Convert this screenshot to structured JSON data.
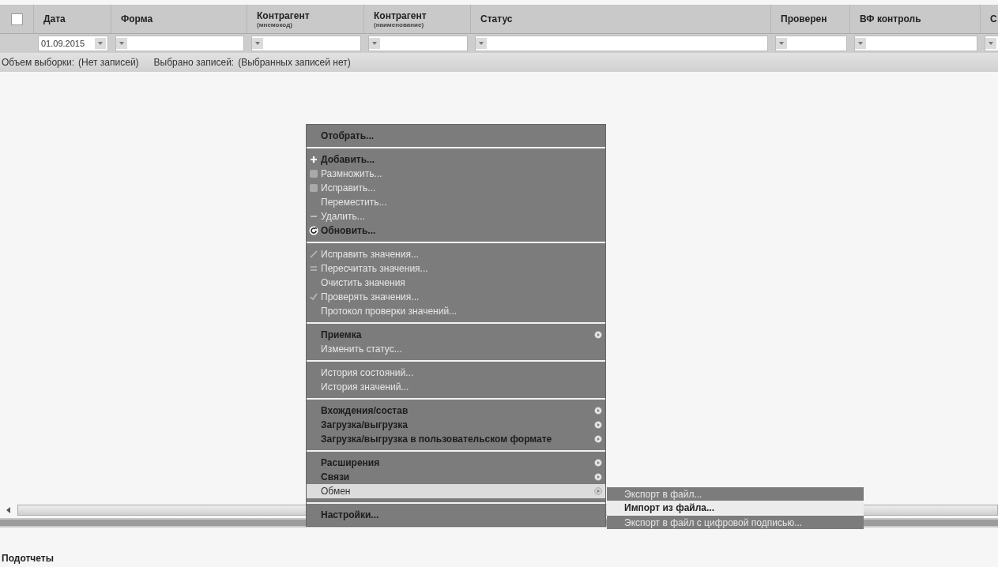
{
  "table": {
    "columns": [
      {
        "label": "Дата",
        "filter": "01.09.2015"
      },
      {
        "label": "Форма"
      },
      {
        "label": "Контрагент",
        "sublabel": "(мнемокод)"
      },
      {
        "label": "Контрагент",
        "sublabel": "(наименование)"
      },
      {
        "label": "Статус"
      },
      {
        "label": "Проверен"
      },
      {
        "label": "ВФ контроль"
      },
      {
        "label": "С"
      }
    ],
    "select_all": {
      "checked": false
    }
  },
  "status_line": [
    {
      "label": "Объем выборки:",
      "value": "(Нет записей)"
    },
    {
      "label": "Выбрано записей:",
      "value": "(Выбранных записей нет)"
    }
  ],
  "context_menu": {
    "groups": [
      {
        "items": [
          {
            "label": "Отобрать...",
            "kind": "plain",
            "disabled": false,
            "selected": false,
            "arrow": false
          }
        ]
      },
      {
        "items": [
          {
            "label": "Добавить...",
            "kind": "add",
            "disabled": false,
            "selected": false,
            "arrow": false
          },
          {
            "label": "Размножить...",
            "kind": "copy",
            "disabled": true,
            "selected": false,
            "arrow": false
          },
          {
            "label": "Исправить...",
            "kind": "copy",
            "disabled": true,
            "selected": false,
            "arrow": false
          },
          {
            "label": "Переместить...",
            "kind": "plain",
            "disabled": true,
            "selected": false,
            "arrow": false
          },
          {
            "label": "Удалить...",
            "kind": "delete",
            "disabled": true,
            "selected": false,
            "arrow": false
          },
          {
            "label": "Обновить...",
            "kind": "refresh",
            "disabled": false,
            "selected": false,
            "arrow": false
          }
        ]
      },
      {
        "items": [
          {
            "label": "Исправить значения...",
            "kind": "edit",
            "disabled": true,
            "selected": false,
            "arrow": false
          },
          {
            "label": "Пересчитать значения...",
            "kind": "recalc",
            "disabled": true,
            "selected": false,
            "arrow": false
          },
          {
            "label": "Очистить значения",
            "kind": "plain",
            "disabled": true,
            "selected": false,
            "arrow": false
          },
          {
            "label": "Проверять значения...",
            "kind": "check",
            "disabled": true,
            "selected": false,
            "arrow": false
          },
          {
            "label": "Протокол проверки значений...",
            "kind": "plain",
            "disabled": true,
            "selected": false,
            "arrow": false
          }
        ]
      },
      {
        "items": [
          {
            "label": "Приемка",
            "kind": "plain",
            "disabled": false,
            "selected": false,
            "arrow": true
          },
          {
            "label": "Изменить статус...",
            "kind": "plain",
            "disabled": true,
            "selected": false,
            "arrow": false
          }
        ]
      },
      {
        "items": [
          {
            "label": "История состояний...",
            "kind": "plain",
            "disabled": true,
            "selected": false,
            "arrow": false
          },
          {
            "label": "История значений...",
            "kind": "plain",
            "disabled": true,
            "selected": false,
            "arrow": false
          }
        ]
      },
      {
        "items": [
          {
            "label": "Вхождения/состав",
            "kind": "plain",
            "disabled": false,
            "selected": false,
            "arrow": true
          },
          {
            "label": "Загрузка/выгрузка",
            "kind": "plain",
            "disabled": false,
            "selected": false,
            "arrow": true
          },
          {
            "label": "Загрузка/выгрузка в пользовательском формате",
            "kind": "plain",
            "disabled": false,
            "selected": false,
            "arrow": true
          }
        ]
      },
      {
        "items": [
          {
            "label": "Расширения",
            "kind": "plain",
            "disabled": false,
            "selected": false,
            "arrow": true
          },
          {
            "label": "Связи",
            "kind": "plain",
            "disabled": false,
            "selected": false,
            "arrow": true
          },
          {
            "label": "Обмен",
            "kind": "plain",
            "disabled": false,
            "selected": true,
            "arrow": true,
            "submenu": {
              "groups": [
                {
                  "items": [
                    {
                      "label": "Экспорт в файл...",
                      "disabled": true,
                      "selected": false
                    },
                    {
                      "label": "Импорт из файла...",
                      "disabled": false,
                      "selected": true
                    }
                  ]
                },
                {
                  "items": [
                    {
                      "label": "Экспорт в файл с цифровой подписью...",
                      "disabled": true,
                      "selected": false
                    }
                  ]
                }
              ]
            }
          }
        ]
      },
      {
        "items": [
          {
            "label": "Настройки...",
            "kind": "plain",
            "disabled": false,
            "selected": false,
            "arrow": false
          }
        ]
      }
    ]
  },
  "subreports": {
    "title": "Подотчеты"
  }
}
